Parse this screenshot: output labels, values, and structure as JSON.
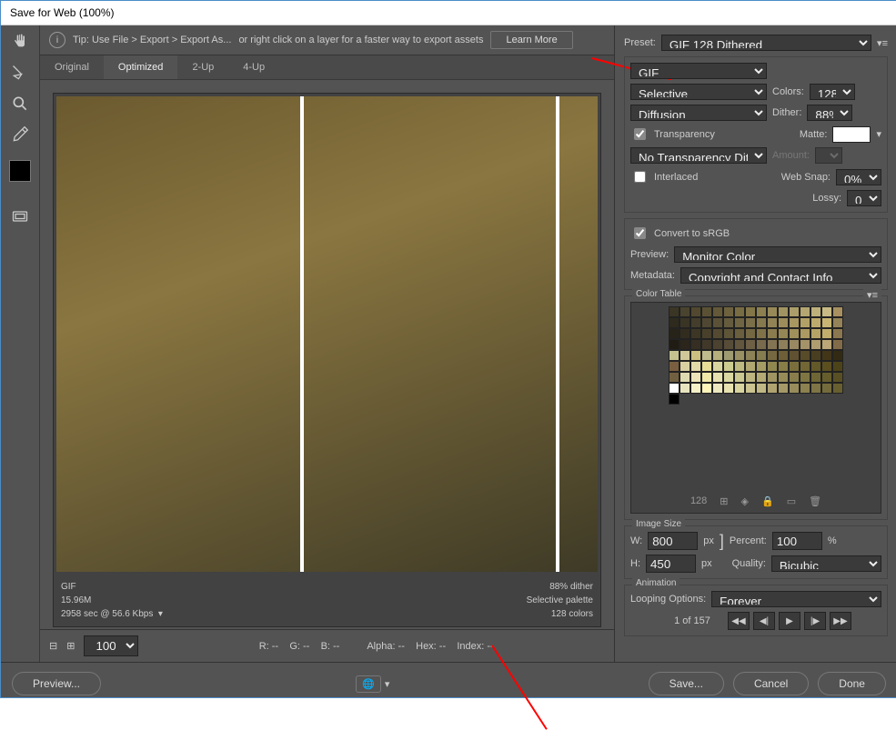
{
  "title": "Save for Web (100%)",
  "tip": {
    "prefix": "Tip: Use File > Export > Export As...",
    "suffix": "or right click on a layer for a faster way to export assets",
    "learn": "Learn More"
  },
  "tabs": [
    "Original",
    "Optimized",
    "2-Up",
    "4-Up"
  ],
  "active_tab": "Optimized",
  "preview_info": {
    "fmt": "GIF",
    "size": "15.96M",
    "time": "2958 sec @ 56.6 Kbps",
    "dither": "88% dither",
    "palette": "Selective palette",
    "colors": "128 colors"
  },
  "zoom": "100%",
  "readout": {
    "r": "R: --",
    "g": "G: --",
    "b": "B: --",
    "alpha": "Alpha: --",
    "hex": "Hex: --",
    "index": "Index: --"
  },
  "preset_label": "Preset:",
  "preset_value": "GIF 128 Dithered",
  "format": "GIF",
  "reduction": "Selective",
  "colors_label": "Colors:",
  "colors_value": "128",
  "dither_alg": "Diffusion",
  "dither_label": "Dither:",
  "dither_value": "88%",
  "transparency_label": "Transparency",
  "matte_label": "Matte:",
  "trans_dither": "No Transparency Dither",
  "amount_label": "Amount:",
  "interlaced_label": "Interlaced",
  "websnap_label": "Web Snap:",
  "websnap_value": "0%",
  "lossy_label": "Lossy:",
  "lossy_value": "0",
  "convert_srgb": "Convert to sRGB",
  "preview_label": "Preview:",
  "preview_value": "Monitor Color",
  "metadata_label": "Metadata:",
  "metadata_value": "Copyright and Contact Info",
  "ct_title": "Color Table",
  "ct_count": "128",
  "img_size_title": "Image Size",
  "w": "800",
  "h": "450",
  "px": "px",
  "percent_label": "Percent:",
  "percent": "100",
  "percent_sym": "%",
  "quality_label": "Quality:",
  "quality": "Bicubic",
  "anim_title": "Animation",
  "loop_label": "Looping Options:",
  "loop_value": "Forever",
  "frame": "1 of 157",
  "btn_preview": "Preview...",
  "btn_save": "Save...",
  "btn_cancel": "Cancel",
  "btn_done": "Done",
  "palette_colors": [
    "#3b3526",
    "#4a432e",
    "#51482f",
    "#5a5134",
    "#635939",
    "#6e623e",
    "#786c43",
    "#837648",
    "#8d8050",
    "#978a58",
    "#a19461",
    "#ab9e6a",
    "#b3a672",
    "#bdb07b",
    "#c7ba84",
    "#a89060",
    "#2e2a1e",
    "#3a3425",
    "#443d2b",
    "#4f4731",
    "#5a5137",
    "#655b3d",
    "#706543",
    "#7b6f49",
    "#86794f",
    "#918355",
    "#9c8d5b",
    "#a79761",
    "#b2a167",
    "#bdab6d",
    "#c8b573",
    "#948358",
    "#272319",
    "#322c1f",
    "#3d3625",
    "#48402b",
    "#534a31",
    "#5e5437",
    "#695e3d",
    "#746843",
    "#7f7249",
    "#8a7c4f",
    "#958655",
    "#a0905b",
    "#ab9a61",
    "#b6a467",
    "#c1ae6d",
    "#8b7750",
    "#201c14",
    "#2b251b",
    "#362e22",
    "#413829",
    "#4c4230",
    "#574c37",
    "#62563e",
    "#6d6045",
    "#786a4c",
    "#837453",
    "#8e7e5a",
    "#998861",
    "#a49268",
    "#af9c6f",
    "#baa676",
    "#826b48",
    "#c5c290",
    "#d0c898",
    "#cdbf80",
    "#bebc8d",
    "#b5b07c",
    "#9f9b70",
    "#989062",
    "#8c8258",
    "#857c50",
    "#766840",
    "#6e5f38",
    "#605230",
    "#584b28",
    "#4a3e20",
    "#423618",
    "#332a13",
    "#795f40",
    "#d8d0a0",
    "#e2daa8",
    "#e8de98",
    "#d9d5a0",
    "#cccc90",
    "#bdb980",
    "#b0a870",
    "#a59c65",
    "#908650",
    "#877d47",
    "#7a6f3c",
    "#716634",
    "#635828",
    "#5b4f20",
    "#4c4318",
    "#716040",
    "#dfdbb0",
    "#ece4b8",
    "#f0e8a8",
    "#e7e1b0",
    "#dad8a0",
    "#cac790",
    "#bdb580",
    "#b4aa74",
    "#a09562",
    "#968c58",
    "#887e4c",
    "#7e7542",
    "#6e6634",
    "#665d2c",
    "#585024",
    "#ffffff",
    "#e8e4c0",
    "#f6f0c8",
    "#fff4ba",
    "#eee8c0",
    "#e8e2b0",
    "#d8d4a0",
    "#cbc390",
    "#c0b784",
    "#b0a370",
    "#a59968",
    "#988c5c",
    "#8c8150",
    "#7e7446",
    "#746b3c",
    "#685f30",
    "#000000"
  ]
}
